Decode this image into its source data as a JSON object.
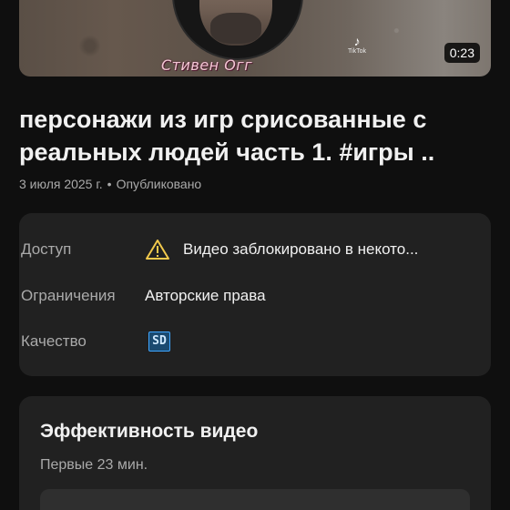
{
  "thumbnail": {
    "caption": "Стивен Огг",
    "tiktok_label": "TikTok",
    "duration": "0:23"
  },
  "video": {
    "title": "персонажи из игр срисованные с реальных людей часть 1.  #игры ..",
    "date": "3 июля 2025 г.",
    "separator": "•",
    "status": "Опубликовано"
  },
  "details": {
    "access_label": "Доступ",
    "access_value": "Видео заблокировано в некото...",
    "access_icon": "warning-icon",
    "restrictions_label": "Ограничения",
    "restrictions_value": "Авторские права",
    "quality_label": "Качество",
    "quality_badge": "SD"
  },
  "performance": {
    "title": "Эффективность видео",
    "subtitle": "Первые 23 мин."
  },
  "colors": {
    "background": "#0f0f0f",
    "card": "#212121",
    "warning": "#f2c94c",
    "sd_badge": "#3ea6ff"
  }
}
